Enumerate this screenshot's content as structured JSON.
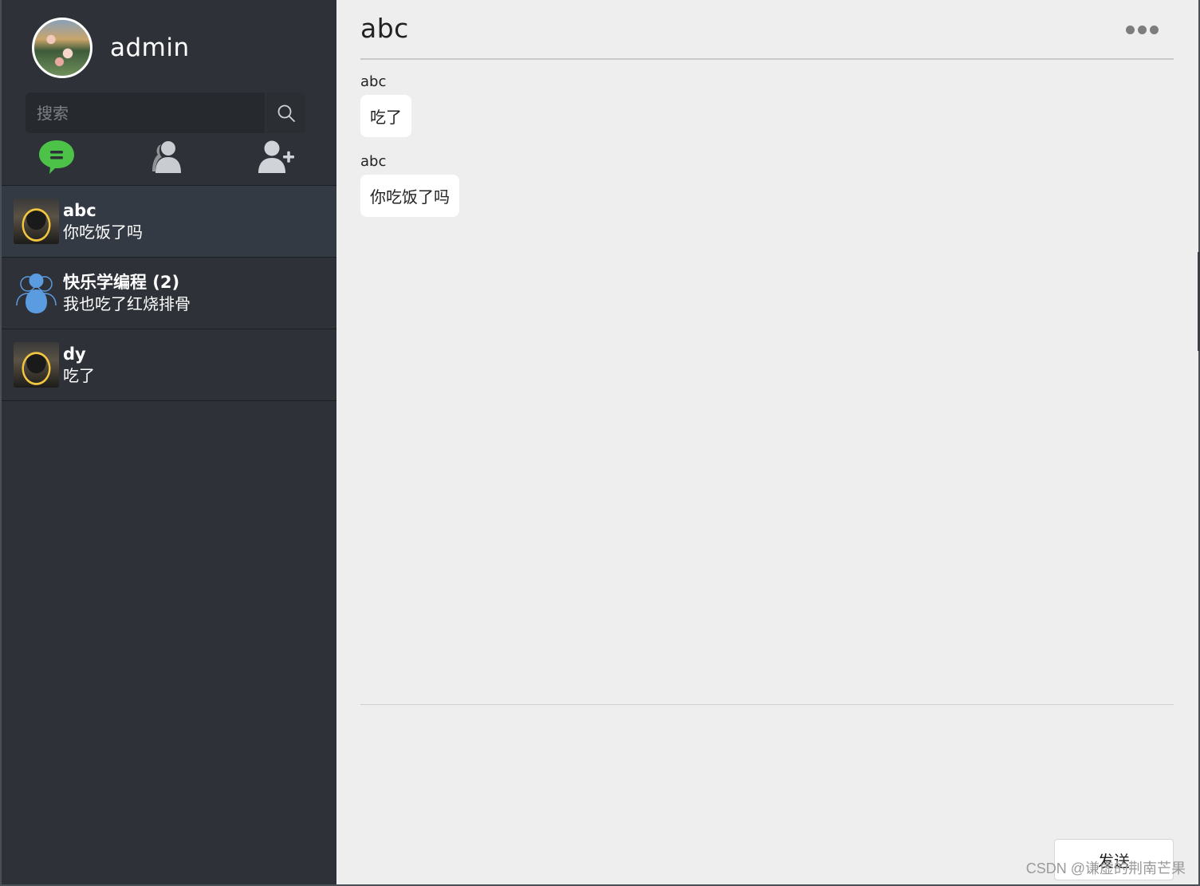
{
  "user": {
    "name": "admin"
  },
  "search": {
    "placeholder": "搜索"
  },
  "conversations": [
    {
      "name": "abc",
      "last_message": "你吃饭了吗"
    },
    {
      "name": "快乐学编程 (2)",
      "last_message": "我也吃了红烧排骨"
    },
    {
      "name": "dy",
      "last_message": "吃了"
    }
  ],
  "chat": {
    "title": "abc",
    "messages": [
      {
        "sender": "abc",
        "text": "吃了"
      },
      {
        "sender": "abc",
        "text": "你吃饭了吗"
      }
    ],
    "send_label": "发送"
  },
  "watermark": "CSDN @谦虚的荆南芒果",
  "colors": {
    "sidebar_bg": "#2e3238",
    "active_item": "#343a44",
    "chat_icon_green": "#4cc249",
    "group_avatar_blue": "#5b9bdf",
    "main_bg": "#eeeeee"
  }
}
